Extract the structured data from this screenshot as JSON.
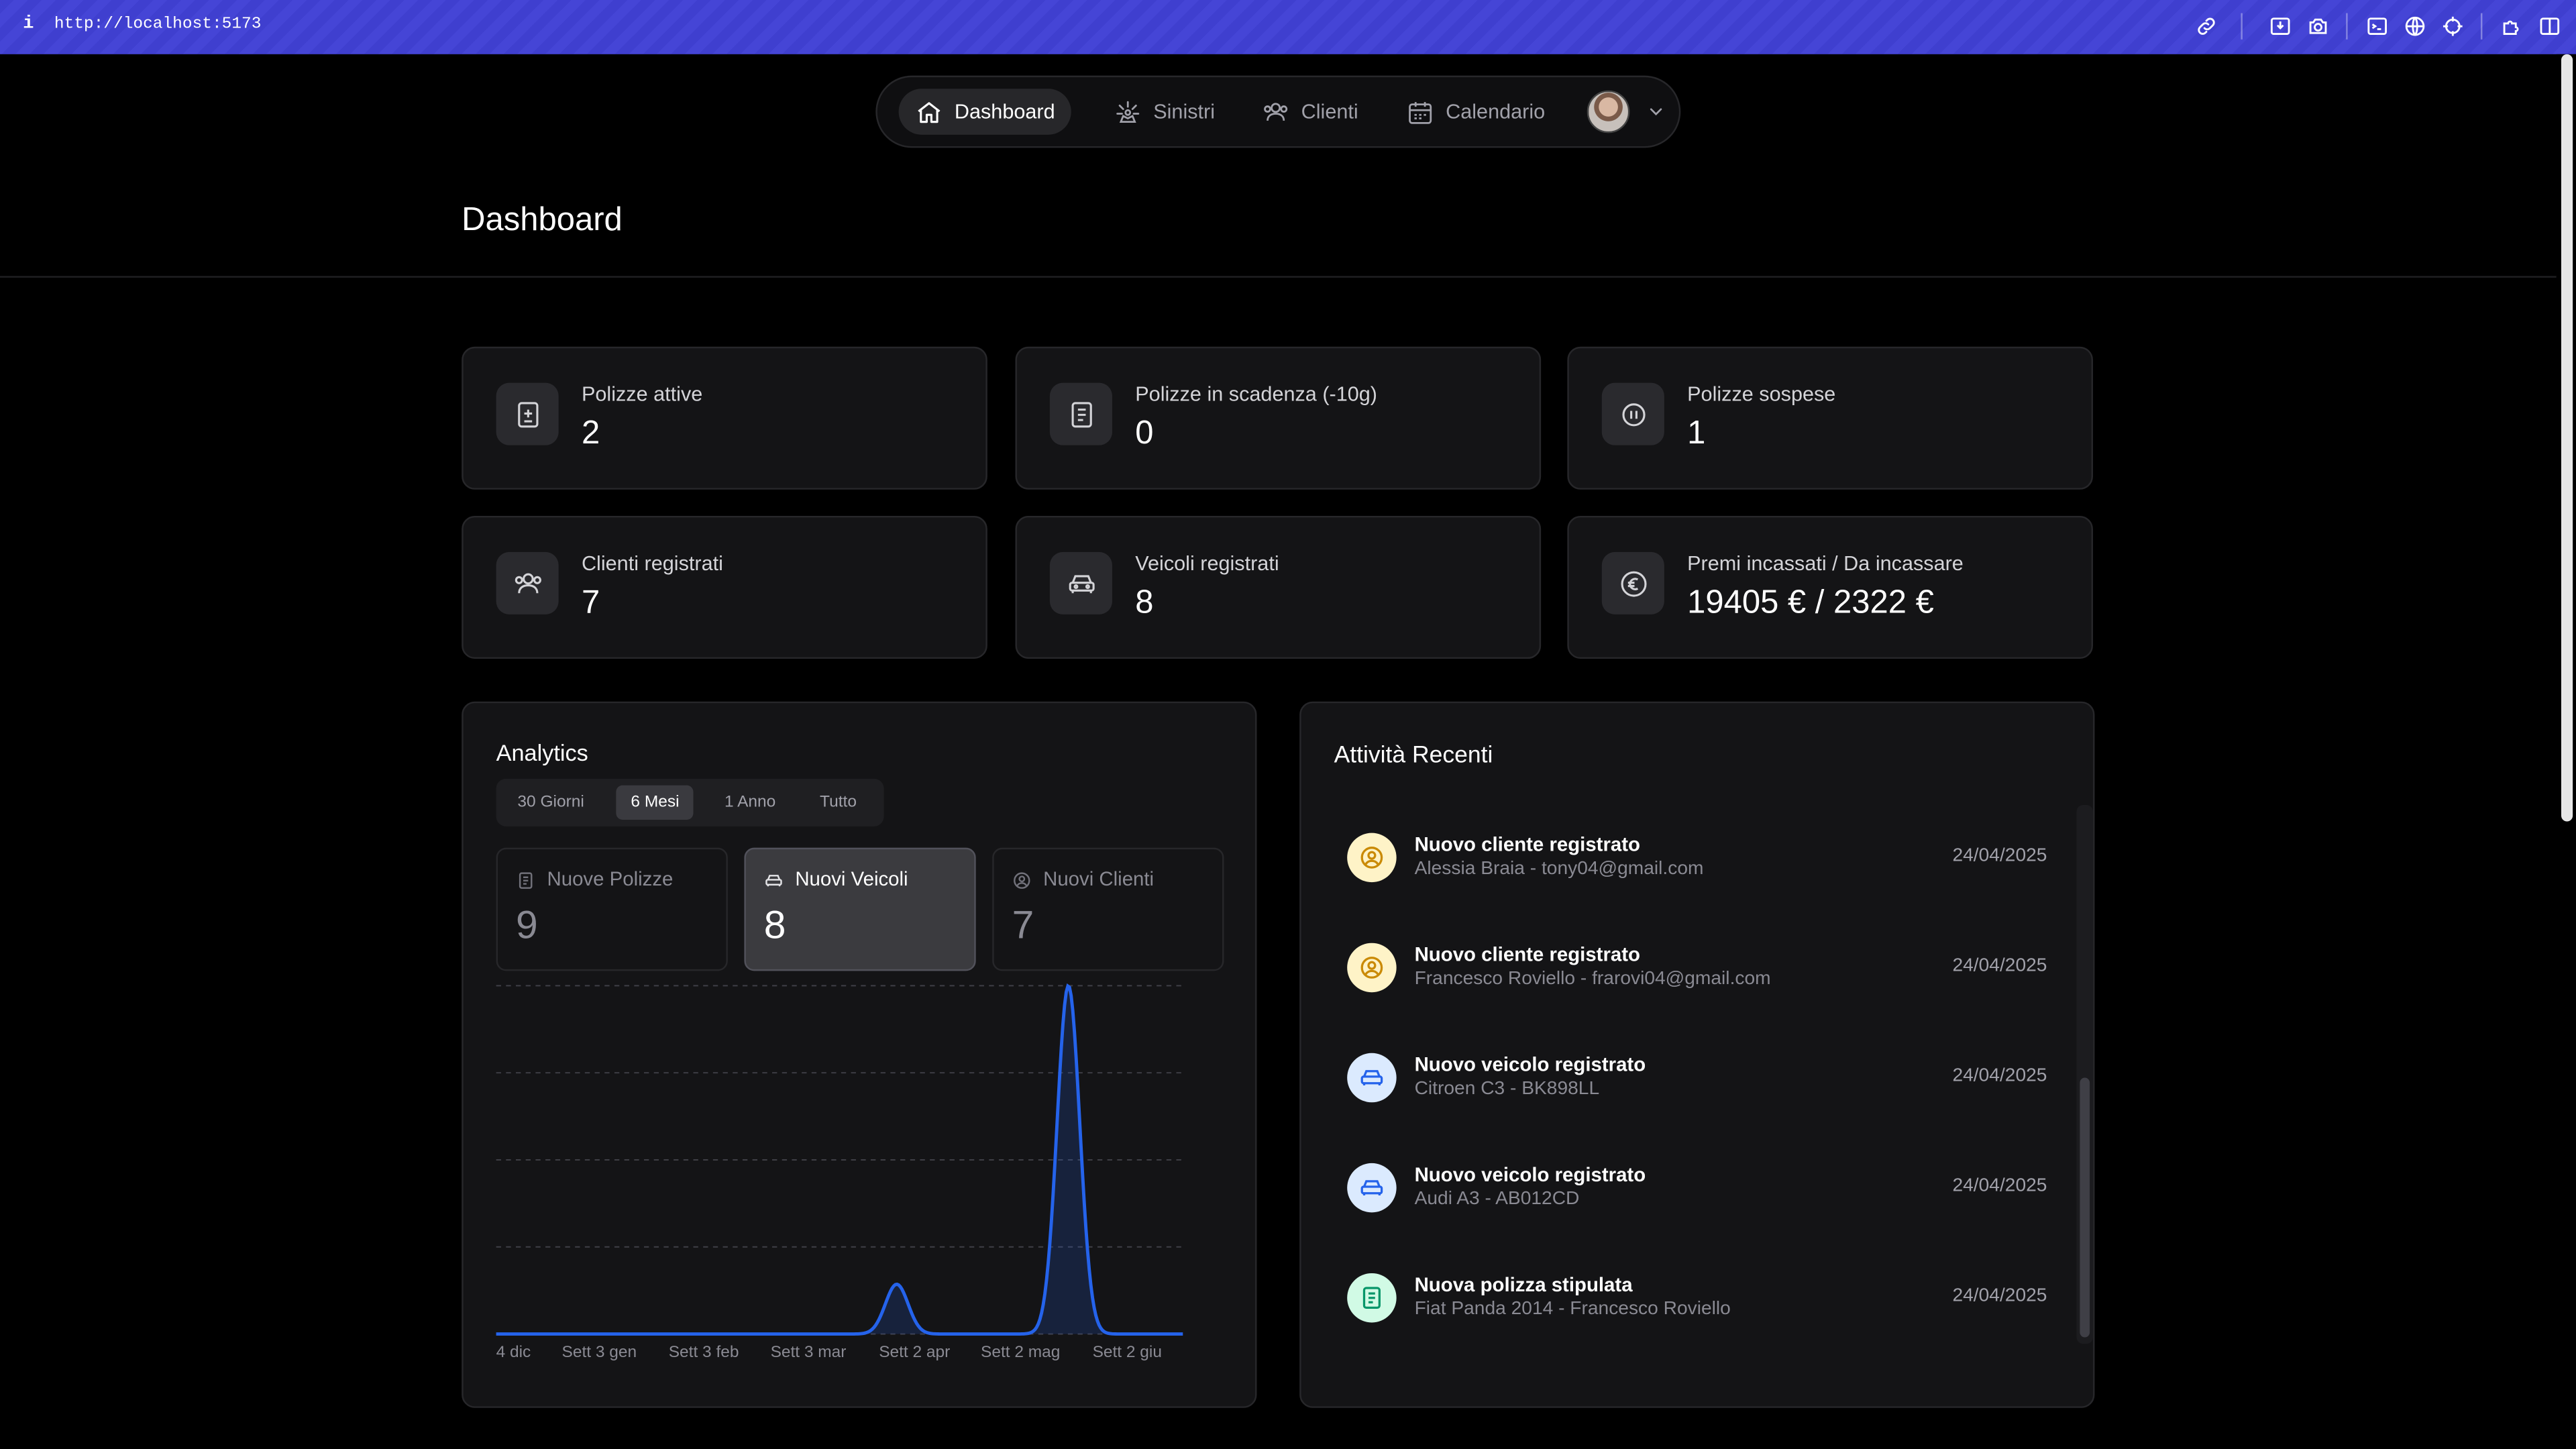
{
  "browser": {
    "info_icon": "i",
    "url": "http://localhost:5173",
    "icons": [
      "link-icon",
      "save-icon",
      "camera-icon",
      "terminal-icon",
      "globe-icon",
      "crosshair-icon",
      "extension-icon",
      "sidebar-icon"
    ]
  },
  "nav": {
    "items": [
      {
        "label": "Dashboard",
        "icon": "home-icon",
        "active": true
      },
      {
        "label": "Sinistri",
        "icon": "incident-icon",
        "active": false
      },
      {
        "label": "Clienti",
        "icon": "users-icon",
        "active": false
      },
      {
        "label": "Calendario",
        "icon": "calendar-icon",
        "active": false
      }
    ],
    "avatar": "user-avatar",
    "menu_icon": "chevron-down-icon"
  },
  "page": {
    "title": "Dashboard"
  },
  "stats": [
    {
      "label": "Polizze attive",
      "value": "2",
      "icon": "policy-add-icon"
    },
    {
      "label": "Polizze in scadenza (-10g)",
      "value": "0",
      "icon": "document-icon"
    },
    {
      "label": "Polizze sospese",
      "value": "1",
      "icon": "pause-circle-icon"
    },
    {
      "label": "Clienti registrati",
      "value": "7",
      "icon": "users-icon"
    },
    {
      "label": "Veicoli registrati",
      "value": "8",
      "icon": "car-icon"
    },
    {
      "label": "Premi incassati / Da incassare",
      "value": "19405 € / 2322 €",
      "icon": "euro-icon"
    }
  ],
  "analytics": {
    "title": "Analytics",
    "ranges": [
      {
        "label": "30 Giorni",
        "active": false
      },
      {
        "label": "6 Mesi",
        "active": true
      },
      {
        "label": "1 Anno",
        "active": false
      },
      {
        "label": "Tutto",
        "active": false
      }
    ],
    "metrics": [
      {
        "label": "Nuove Polizze",
        "value": "9",
        "icon": "document-icon",
        "active": false
      },
      {
        "label": "Nuovi Veicoli",
        "value": "8",
        "icon": "car-icon",
        "active": true
      },
      {
        "label": "Nuovi Clienti",
        "value": "7",
        "icon": "user-icon",
        "active": false
      }
    ]
  },
  "chart_data": {
    "type": "area",
    "title": "",
    "xlabel": "",
    "ylabel": "",
    "grid": true,
    "line_color": "#2563eb",
    "x": [
      "4 dic",
      "Sett 3 gen",
      "Sett 3 feb",
      "Sett 3 mar",
      "Sett 2 apr",
      "Sett 2 mag",
      "Sett 2 giu"
    ],
    "series": [
      {
        "values": [
          0,
          0,
          0,
          1,
          0,
          7,
          0
        ],
        "peak_positions": [
          3.5,
          5.0
        ]
      }
    ],
    "ylim": [
      0,
      7
    ]
  },
  "activity": {
    "title": "Attività Recenti",
    "items": [
      {
        "title": "Nuovo cliente registrato",
        "subtitle": "Alessia Braia - tony04@gmail.com",
        "date": "24/04/2025",
        "icon": "user-icon",
        "color": "#eab308"
      },
      {
        "title": "Nuovo cliente registrato",
        "subtitle": "Francesco Roviello - frarovi04@gmail.com",
        "date": "24/04/2025",
        "icon": "user-icon",
        "color": "#eab308"
      },
      {
        "title": "Nuovo veicolo registrato",
        "subtitle": "Citroen C3 - BK898LL",
        "date": "24/04/2025",
        "icon": "car-icon",
        "color": "#3b82f6"
      },
      {
        "title": "Nuovo veicolo registrato",
        "subtitle": "Audi A3 - AB012CD",
        "date": "24/04/2025",
        "icon": "car-icon",
        "color": "#3b82f6"
      },
      {
        "title": "Nuova polizza stipulata",
        "subtitle": "Fiat Panda 2014 - Francesco Roviello",
        "date": "24/04/2025",
        "icon": "document-icon",
        "color": "#10b981"
      }
    ]
  }
}
